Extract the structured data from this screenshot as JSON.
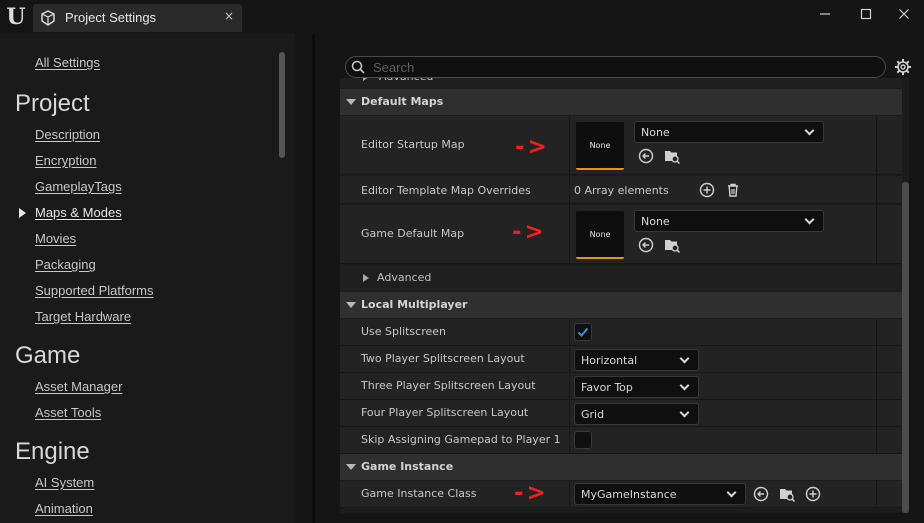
{
  "window": {
    "tab_title": "Project Settings",
    "close_glyph": "×",
    "minimize_glyph": "—",
    "maximize_glyph": "☐",
    "close_window_glyph": "✕"
  },
  "nav": {
    "all_settings": "All Settings",
    "sections": [
      {
        "heading": "Project",
        "items": [
          "Description",
          "Encryption",
          "GameplayTags",
          "Maps & Modes",
          "Movies",
          "Packaging",
          "Supported Platforms",
          "Target Hardware"
        ]
      },
      {
        "heading": "Game",
        "items": [
          "Asset Manager",
          "Asset Tools"
        ]
      },
      {
        "heading": "Engine",
        "items": [
          "AI System",
          "Animation"
        ]
      }
    ],
    "active_item": "Maps & Modes"
  },
  "search": {
    "placeholder": "Search"
  },
  "details": {
    "advanced_label": "Advanced",
    "default_maps": {
      "title": "Default Maps",
      "editor_startup_map": {
        "label": "Editor Startup Map",
        "thumb": "None",
        "value": "None"
      },
      "editor_template_map_overrides": {
        "label": "Editor Template Map Overrides",
        "value": "0 Array elements"
      },
      "game_default_map": {
        "label": "Game Default Map",
        "thumb": "None",
        "value": "None"
      }
    },
    "local_multiplayer": {
      "title": "Local Multiplayer",
      "use_splitscreen": {
        "label": "Use Splitscreen",
        "checked": true
      },
      "two_player": {
        "label": "Two Player Splitscreen Layout",
        "value": "Horizontal"
      },
      "three_player": {
        "label": "Three Player Splitscreen Layout",
        "value": "Favor Top"
      },
      "four_player": {
        "label": "Four Player Splitscreen Layout",
        "value": "Grid"
      },
      "skip_gamepad": {
        "label": "Skip Assigning Gamepad to Player 1",
        "checked": false
      }
    },
    "game_instance": {
      "title": "Game Instance",
      "game_instance_class": {
        "label": "Game Instance Class",
        "value": "MyGameInstance"
      }
    }
  },
  "annotations": {
    "arrow_text": "->"
  },
  "colors": {
    "accent_orange": "#e8921e",
    "check_blue": "#3a8fe8",
    "annotation_red": "#ef2020"
  }
}
